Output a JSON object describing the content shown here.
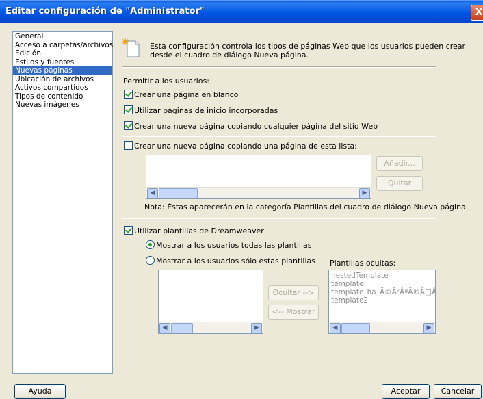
{
  "window": {
    "title": "Editar configuración de \"Administrator\"",
    "close_label": "X"
  },
  "categories": [
    {
      "label": "General",
      "selected": false
    },
    {
      "label": "Acceso a carpetas/archivos",
      "selected": false
    },
    {
      "label": "Edición",
      "selected": false
    },
    {
      "label": "Estilos y fuentes",
      "selected": false
    },
    {
      "label": "Nuevas páginas",
      "selected": true
    },
    {
      "label": "Ubicación de archivos",
      "selected": false
    },
    {
      "label": "Activos compartidos",
      "selected": false
    },
    {
      "label": "Tipos de contenido",
      "selected": false
    },
    {
      "label": "Nuevas imágenes",
      "selected": false
    }
  ],
  "header": {
    "description_line1": "Esta configuración controla los tipos de páginas Web que los usuarios pueden crear",
    "description_line2": "desde el cuadro de diálogo Nueva página."
  },
  "permissions": {
    "label": "Permitir a los usuarios:",
    "blank_page": {
      "label": "Crear una página en blanco",
      "checked": true
    },
    "builtin_pages": {
      "label": "Utilizar páginas de inicio incorporadas",
      "checked": true
    },
    "copy_any_page": {
      "label": "Crear una nueva página copiando cualquier página del sitio Web",
      "checked": true
    }
  },
  "copy_from_list": {
    "label": "Crear una nueva página copiando una página de esta lista:",
    "checked": false,
    "add_button": "Añadir...",
    "remove_button": "Quitar",
    "note": "Nota: Éstas aparecerán en la categoría Plantillas del cuadro de diálogo Nueva página."
  },
  "templates": {
    "label": "Utilizar plantillas de Dreamweaver",
    "checked": true,
    "show_all": {
      "label": "Mostrar a los usuarios todas las plantillas",
      "selected": true
    },
    "show_only": {
      "label": "Mostrar a los usuarios sólo estas plantillas",
      "selected": false
    },
    "hidden_label": "Plantillas ocultas:",
    "hide_button": "Ocultar -->",
    "show_button": "<-- Mostrar",
    "hidden_items": [
      "nestedTemplate",
      "template",
      "template_ha_Ã©Â²ÂªÃ®Â□Â",
      "template2"
    ]
  },
  "footer": {
    "help": "Ayuda",
    "ok": "Aceptar",
    "cancel": "Cancelar"
  },
  "colors": {
    "selection": "#316ac5",
    "titlebar": "#0055e5",
    "dialog_bg": "#ece9d8"
  }
}
